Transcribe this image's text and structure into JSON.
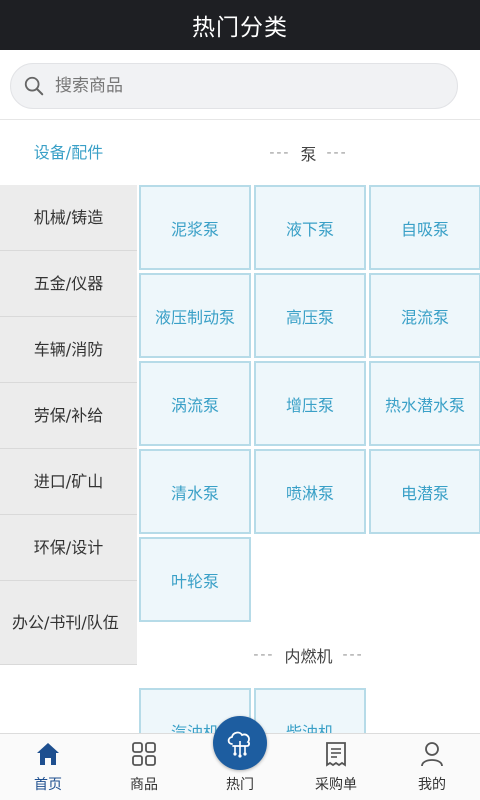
{
  "header": {
    "title": "热门分类"
  },
  "search": {
    "placeholder": "搜索商品"
  },
  "sidebar": {
    "items": [
      {
        "label": "设备/配件"
      },
      {
        "label": "机械/铸造"
      },
      {
        "label": "五金/仪器"
      },
      {
        "label": "车辆/消防"
      },
      {
        "label": "劳保/补给"
      },
      {
        "label": "进口/矿山"
      },
      {
        "label": "环保/设计"
      },
      {
        "label": "办公/书刊/队伍"
      }
    ]
  },
  "sections": [
    {
      "title": "泵",
      "items": [
        "泥浆泵",
        "液下泵",
        "自吸泵",
        "液压制动泵",
        "高压泵",
        "混流泵",
        "涡流泵",
        "增压泵",
        "热水潜水泵",
        "清水泵",
        "喷淋泵",
        "电潜泵",
        "叶轮泵"
      ]
    },
    {
      "title": "内燃机",
      "items": [
        "汽油机",
        "柴油机"
      ]
    }
  ],
  "section_dash": "---",
  "tabbar": {
    "items": [
      {
        "label": "首页",
        "icon": "home-icon"
      },
      {
        "label": "商品",
        "icon": "grid-icon"
      },
      {
        "label": "热门",
        "icon": "cloud-network-icon"
      },
      {
        "label": "采购单",
        "icon": "cart-list-icon"
      },
      {
        "label": "我的",
        "icon": "user-icon"
      }
    ]
  },
  "colors": {
    "accent": "#3aa0c7",
    "primary": "#1d5da0",
    "titlebar": "#1e1f23"
  }
}
